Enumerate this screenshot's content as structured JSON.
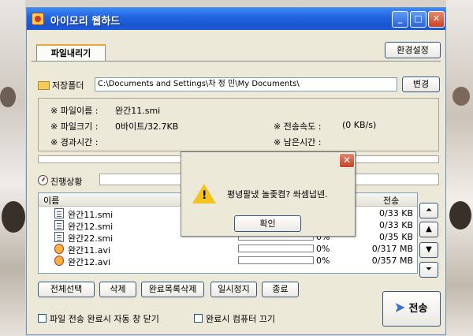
{
  "window": {
    "title": "아이모리 웹하드",
    "titlebar_buttons": [
      "minimize",
      "maximize",
      "close"
    ]
  },
  "tab": {
    "label": "파일내리기"
  },
  "settings_button": "환경설정",
  "save_folder": {
    "label": "저장폴더",
    "path": "C:\\Documents and Settings\\차 정 민\\My Documents\\",
    "change_button": "변경"
  },
  "info": {
    "file_name_label": "※ 파일이름 :",
    "file_name_value": "완간11.smi",
    "file_size_label": "※ 파일크기 :",
    "file_size_value": "0바이트/32.7KB",
    "elapsed_label": "※ 경과시간 :",
    "speed_label": "※ 전송속도 :",
    "speed_value": "(0 KB/s)",
    "remaining_label": "※ 남은시간 :"
  },
  "progress": {
    "label": "진행상황"
  },
  "file_list": {
    "columns": {
      "name": "이름",
      "transfer": "전송"
    },
    "rows": [
      {
        "name": "완간11.smi",
        "percent": "",
        "size": "0/33 KB",
        "type": "doc"
      },
      {
        "name": "완간12.smi",
        "percent": "",
        "size": "0/33 KB",
        "type": "doc"
      },
      {
        "name": "완간22.smi",
        "percent": "0%",
        "size": "0/35 KB",
        "type": "doc"
      },
      {
        "name": "완간11.avi",
        "percent": "0%",
        "size": "0/317 MB",
        "type": "avi"
      },
      {
        "name": "완간12.avi",
        "percent": "0%",
        "size": "0/357 MB",
        "type": "avi"
      }
    ]
  },
  "side_buttons": [
    "move-top",
    "move-up",
    "move-down",
    "move-bottom"
  ],
  "actions": {
    "select_all": "전체선택",
    "delete": "삭제",
    "delete_completed": "완료목록삭제",
    "pause": "일시정지",
    "exit": "종료"
  },
  "options": {
    "auto_close": "파일 전송 완료시 자동 창 닫기",
    "shutdown": "완료시 컴퓨터 끄기"
  },
  "send_button": "전송",
  "dialog": {
    "message": "평녕팔냈 놀좇켬? 쏴셈넙넨.",
    "ok": "확인"
  }
}
